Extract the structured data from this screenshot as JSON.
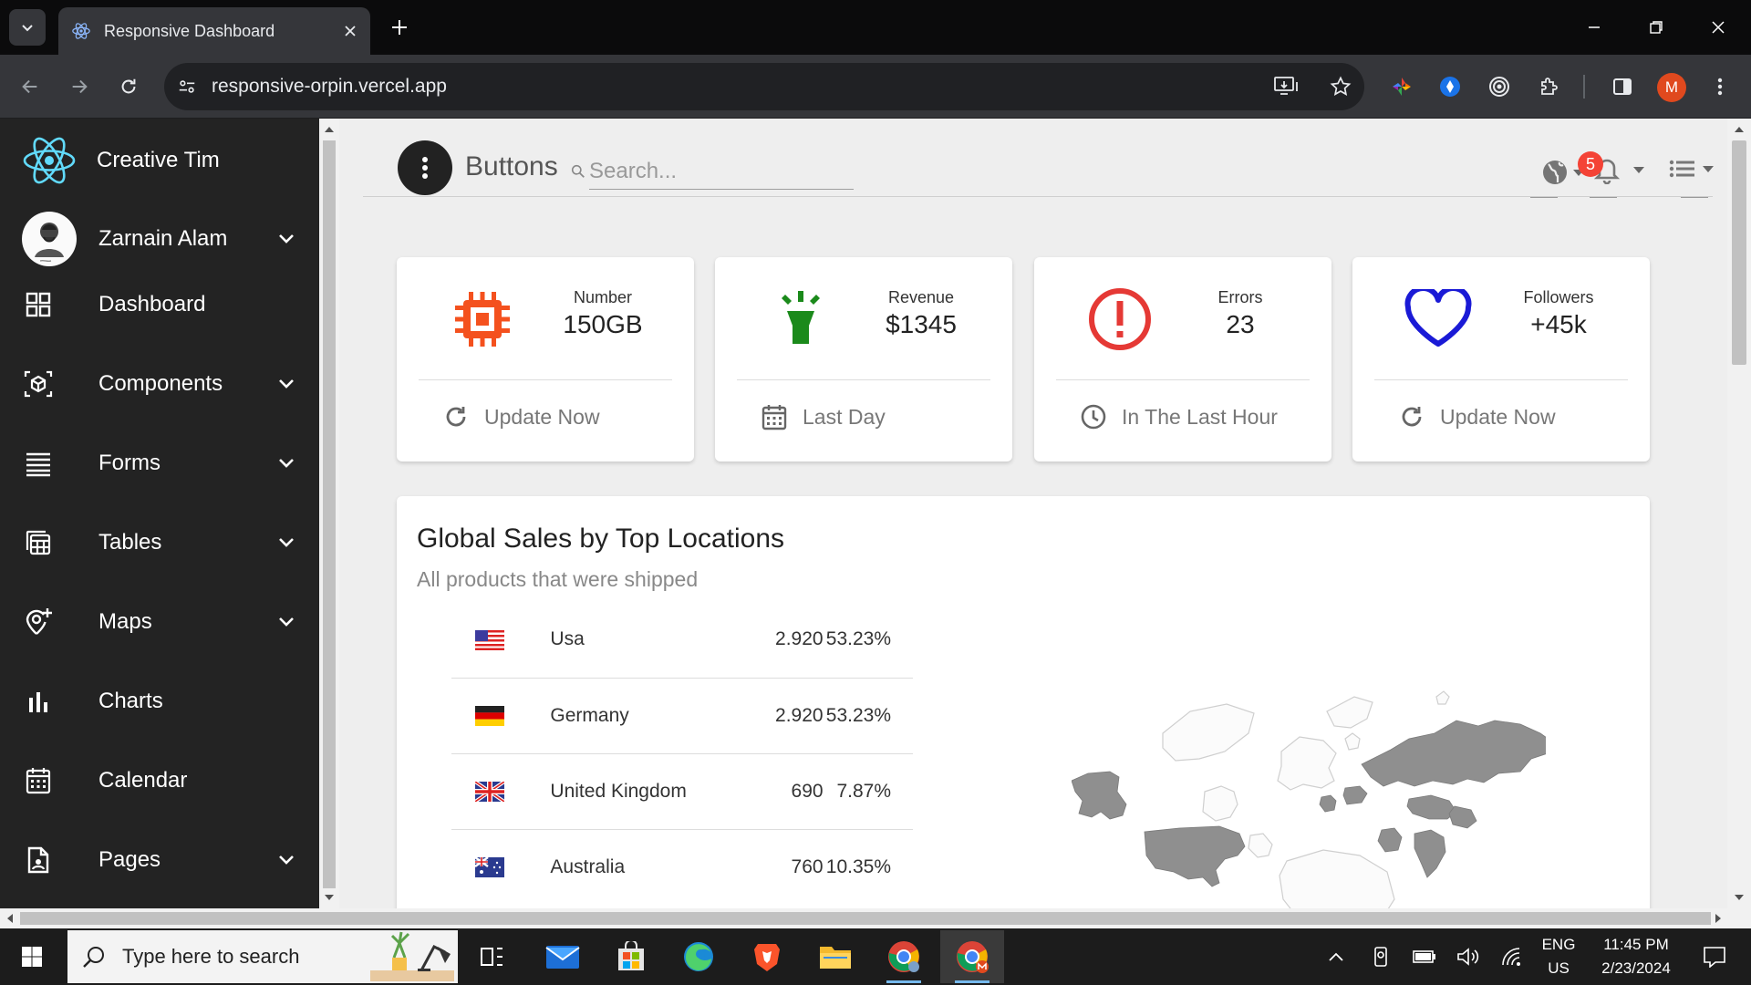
{
  "browser": {
    "tab_title": "Responsive Dashboard",
    "url": "responsive-orpin.vercel.app",
    "profile_initial": "M",
    "profile_color": "#e0491e"
  },
  "sidebar": {
    "brand": "Creative Tim",
    "user": "Zarnain Alam",
    "items": [
      {
        "label": "Dashboard",
        "icon": "dashboard-grid-icon",
        "expandable": false
      },
      {
        "label": "Components",
        "icon": "cube-icon",
        "expandable": true
      },
      {
        "label": "Forms",
        "icon": "list-icon",
        "expandable": true
      },
      {
        "label": "Tables",
        "icon": "table-icon",
        "expandable": true
      },
      {
        "label": "Maps",
        "icon": "map-pin-add-icon",
        "expandable": true
      },
      {
        "label": "Charts",
        "icon": "bar-chart-icon",
        "expandable": false
      },
      {
        "label": "Calendar",
        "icon": "calendar-icon",
        "expandable": false
      },
      {
        "label": "Pages",
        "icon": "page-icon",
        "expandable": true
      }
    ]
  },
  "header": {
    "brand_text": "Buttons",
    "search_placeholder": "Search...",
    "notification_count": "5"
  },
  "stats": [
    {
      "caption": "Number",
      "value": "150GB",
      "footer": "Update Now",
      "icon": "chip-icon",
      "footer_icon": "refresh-icon",
      "color": "#f4511e"
    },
    {
      "caption": "Revenue",
      "value": "$1345",
      "footer": "Last Day",
      "icon": "lightbulb-icon",
      "footer_icon": "calendar-icon",
      "color": "#1b8a1b"
    },
    {
      "caption": "Errors",
      "value": "23",
      "footer": "In The Last Hour",
      "icon": "alert-circle-icon",
      "footer_icon": "clock-icon",
      "color": "#e53935"
    },
    {
      "caption": "Followers",
      "value": "+45k",
      "footer": "Update Now",
      "icon": "heart-icon",
      "footer_icon": "refresh-icon",
      "color": "#1a1ad6"
    }
  ],
  "sales": {
    "title": "Global Sales by Top Locations",
    "subtitle": "All products that were shipped",
    "rows": [
      {
        "country": "Usa",
        "value": "2.920",
        "percent": "53.23%",
        "flag": "us-flag"
      },
      {
        "country": "Germany",
        "value": "2.920",
        "percent": "53.23%",
        "flag": "de-flag"
      },
      {
        "country": "United Kingdom",
        "value": "690",
        "percent": "7.87%",
        "flag": "gb-flag"
      },
      {
        "country": "Australia",
        "value": "760",
        "percent": "10.35%",
        "flag": "au-flag"
      }
    ]
  },
  "taskbar": {
    "search_placeholder": "Type here to search",
    "lang": "ENG",
    "region": "US",
    "time": "11:45 PM",
    "date": "2/23/2024"
  }
}
